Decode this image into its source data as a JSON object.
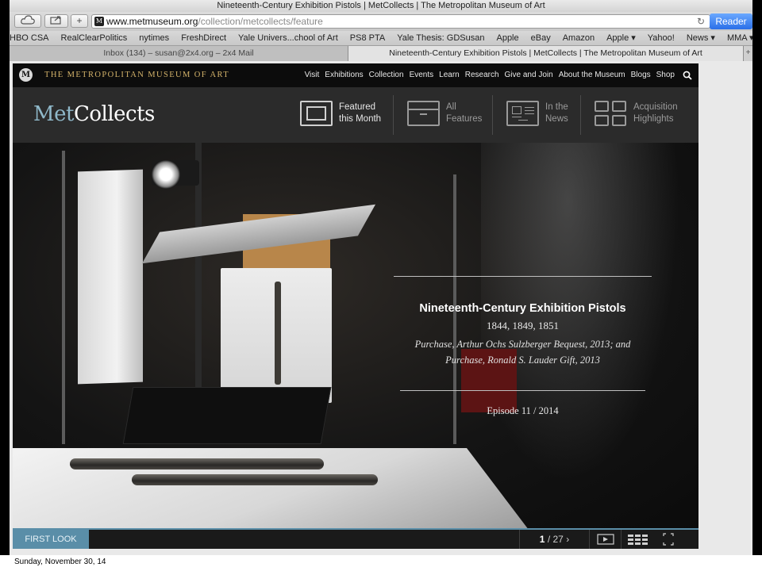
{
  "browser": {
    "window_title": "Nineteenth-Century Exhibition Pistols | MetCollects | The Metropolitan Museum of Art",
    "url_host": "www.metmuseum.org",
    "url_path": "/collection/metcollects/feature",
    "reader_label": "Reader",
    "reload_icon": "reload-icon",
    "bookmarks": [
      "HBO CSA",
      "RealClearPolitics",
      "nytimes",
      "FreshDirect",
      "Yale Univers...chool of Art",
      "PS8 PTA",
      "Yale Thesis: GDSusan",
      "Apple",
      "eBay",
      "Amazon",
      "Apple ▾",
      "Yahoo!",
      "News ▾",
      "MMA ▾"
    ],
    "tabs": [
      {
        "label": "Inbox (134) – susan@2x4.org – 2x4 Mail",
        "active": false
      },
      {
        "label": "Nineteenth-Century Exhibition Pistols | MetCollects | The Metropolitan Museum of Art",
        "active": true
      }
    ],
    "new_tab_label": "+"
  },
  "met": {
    "logo_letter": "M",
    "museum_name": "THE METROPOLITAN MUSEUM OF ART",
    "nav": [
      "Visit",
      "Exhibitions",
      "Collection",
      "Events",
      "Learn",
      "Research",
      "Give and Join",
      "About the Museum",
      "Blogs",
      "Shop"
    ],
    "search_icon": "search-icon"
  },
  "collects": {
    "logo_met": "Met",
    "logo_collects": "Collects",
    "features": [
      {
        "label": "Featured\nthis Month",
        "icon": "frame-icon",
        "active": true
      },
      {
        "label": "All\nFeatures",
        "icon": "box-icon",
        "active": false
      },
      {
        "label": "In the\nNews",
        "icon": "newspaper-icon",
        "active": false
      },
      {
        "label": "Acquisition\nHighlights",
        "icon": "grid-icon",
        "active": false
      }
    ]
  },
  "feature": {
    "title": "Nineteenth-Century Exhibition Pistols",
    "years": "1844, 1849, 1851",
    "credit_line1": "Purchase, Arthur Ochs Sulzberger Bequest, 2013; and",
    "credit_line2": "Purchase, Ronald S. Lauder Gift, 2013",
    "episode": "Episode 11 / 2014"
  },
  "bottom": {
    "first_look": "FIRST LOOK",
    "page_current": "1",
    "page_total": "/ 27",
    "next_icon": "chevron-right-icon",
    "play_icon": "play-icon",
    "grid_icon": "thumbnail-grid-icon",
    "fullscreen_icon": "fullscreen-icon"
  },
  "footer_date": "Sunday, November 30, 14",
  "colors": {
    "accent": "#5a8ea8",
    "met_gold": "#d4b36a",
    "reader_blue": "#2a6fe8",
    "met_light_blue": "#8fb8c9"
  }
}
